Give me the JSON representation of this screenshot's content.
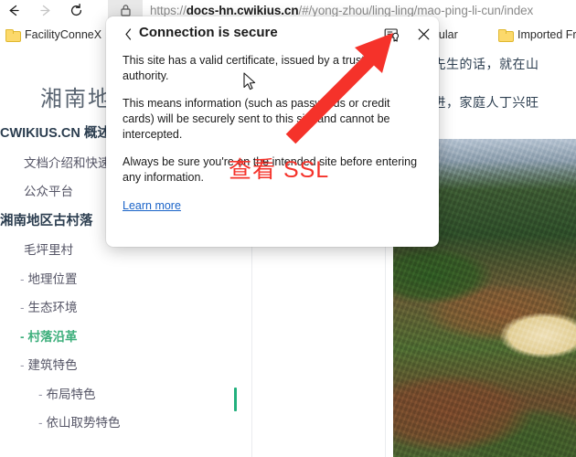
{
  "browser": {
    "nav": {
      "back_label": "Back",
      "forward_label": "Forward",
      "reload_label": "Reload"
    },
    "omnibox": {
      "lock_icon": "lock-icon",
      "url_domain": "docs-hn.cwikius.cn",
      "url_scheme": "https://",
      "url_path": "/#/yong-zhou/ling-ling/mao-ping-li-cun/index",
      "url_full": "https://docs-hn.cwikius.cn/#/yong-zhou/ling-ling/mao-ping-li-cun/index"
    },
    "bookmarks": [
      {
        "label": "FacilityConneX",
        "icon": "folder-icon"
      },
      {
        "label": "",
        "icon": "folder-icon"
      },
      {
        "label": "opular",
        "icon": ""
      },
      {
        "label": "Imported From S",
        "icon": "folder-icon"
      }
    ]
  },
  "popup": {
    "title": "Connection is secure",
    "back_icon": "chevron-left-icon",
    "cert_icon": "certificate-icon",
    "close_icon": "close-icon",
    "paragraphs": [
      "This site has a valid certificate, issued by a trusted authority.",
      "This means information (such as passwords or credit cards) will be securely sent to this site and cannot be intercepted.",
      "Always be sure you're on the intended site before entering any information."
    ],
    "learn_more": "Learn more"
  },
  "annotation": {
    "text": "查看 SSL",
    "color": "#f5322a",
    "arrow": "red-arrow-annotation"
  },
  "page": {
    "heading": "湘南地",
    "active_color": "#3eaf7c",
    "sidebar": [
      {
        "label": "CWIKIUS.CN 概述",
        "level": "h",
        "active": false,
        "dash": ""
      },
      {
        "label": "文档介绍和快速链",
        "level": "1",
        "active": false,
        "dash": ""
      },
      {
        "label": "公众平台",
        "level": "1",
        "active": false,
        "dash": ""
      },
      {
        "label": "湘南地区古村落",
        "level": "h",
        "active": false,
        "dash": ""
      },
      {
        "label": "毛坪里村",
        "level": "1",
        "active": false,
        "dash": ""
      },
      {
        "label": "地理位置",
        "level": "2",
        "active": false,
        "dash": "-"
      },
      {
        "label": "生态环境",
        "level": "2",
        "active": false,
        "dash": "-"
      },
      {
        "label": "村落沿革",
        "level": "2",
        "active": true,
        "dash": "-"
      },
      {
        "label": "建筑特色",
        "level": "2",
        "active": false,
        "dash": "-"
      },
      {
        "label": "布局特色",
        "level": "3",
        "active": false,
        "dash": "-"
      },
      {
        "label": "依山取势特色",
        "level": "3",
        "active": false,
        "dash": "-"
      }
    ],
    "article": {
      "line1": "信风水先生的话，就在山",
      "line2": "不断推进，家庭人丁兴旺",
      "photo_alt": "terraced-farmland-photo"
    }
  }
}
